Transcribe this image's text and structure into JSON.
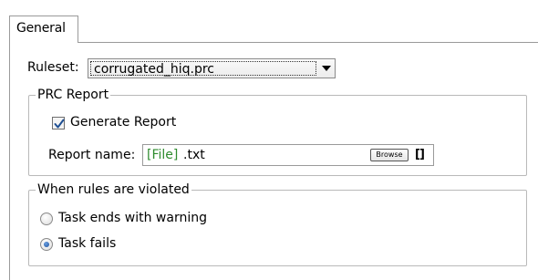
{
  "tabs": [
    {
      "label": "General",
      "selected": true
    }
  ],
  "ruleset": {
    "label": "Ruleset:",
    "value": "corrugated_hiq.prc"
  },
  "prc_report": {
    "title": "PRC Report",
    "generate_report": {
      "label": "Generate Report",
      "checked": true
    },
    "report_name": {
      "label": "Report name:",
      "token": "[File]",
      "suffix": ".txt",
      "token_color": "#2e8b2e",
      "browse_label": "Browse",
      "brackets_label": "[]"
    }
  },
  "violations": {
    "title": "When rules are violated",
    "options": [
      {
        "label": "Task ends with warning",
        "selected": false
      },
      {
        "label": "Task fails",
        "selected": true
      }
    ]
  },
  "icons": {
    "checkbox": "checkmark-icon",
    "combo": "chevron-down-icon",
    "radio_selected": "radio-dot-icon"
  }
}
